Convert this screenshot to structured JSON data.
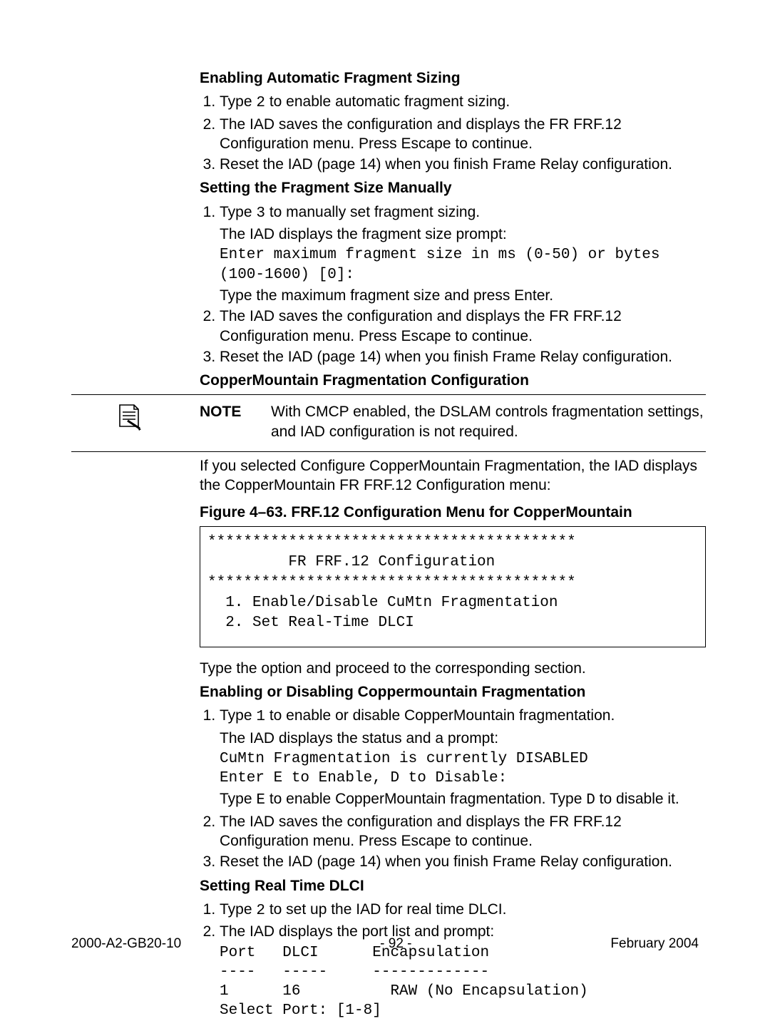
{
  "section1": {
    "heading": "Enabling Automatic Fragment Sizing",
    "step1_a": "Type ",
    "step1_key": "2",
    "step1_b": " to enable automatic fragment sizing.",
    "step2": "The IAD saves the configuration and displays the FR FRF.12 Configuration menu. Press Escape to continue.",
    "step3": "Reset the IAD (page 14) when you finish Frame Relay configuration."
  },
  "section2": {
    "heading": "Setting the Fragment Size Manually",
    "step1_a": "Type ",
    "step1_key": "3",
    "step1_b": " to manually set fragment sizing.",
    "step1_line2": "The IAD displays the fragment size prompt:",
    "step1_prompt": "Enter maximum fragment size in ms (0-50) or bytes (100-1600) [0]:",
    "step1_line3": "Type the maximum fragment size and press Enter.",
    "step2": "The IAD saves the configuration and displays the FR FRF.12 Configuration menu. Press Escape to continue.",
    "step3": "Reset the IAD (page 14) when you finish Frame Relay configuration."
  },
  "section3": {
    "heading": "CopperMountain Fragmentation Configuration",
    "note_label": "NOTE",
    "note_text": "With CMCP enabled, the DSLAM controls fragmentation settings, and IAD configuration is not required.",
    "para1": "If you selected Configure CopperMountain Fragmentation, the IAD displays the CopperMountain FR FRF.12 Configuration menu:",
    "figcap": "Figure 4–63.  FRF.12 Configuration Menu for CopperMountain",
    "codebox": "*****************************************\n         FR FRF.12 Configuration\n*****************************************\n  1. Enable/Disable CuMtn Fragmentation\n  2. Set Real-Time DLCI",
    "para2": "Type the option and proceed to the corresponding section."
  },
  "section4": {
    "heading": "Enabling or Disabling Coppermountain Fragmentation",
    "step1_a": "Type ",
    "step1_key": "1",
    "step1_b": " to enable or disable CopperMountain fragmentation.",
    "step1_line2": "The IAD displays the status and a prompt:",
    "step1_prompt": "CuMtn Fragmentation is currently DISABLED\nEnter E to Enable, D to Disable:",
    "step1_line3a": "Type ",
    "step1_key_e": "E",
    "step1_line3b": " to enable CopperMountain fragmentation. Type ",
    "step1_key_d": "D",
    "step1_line3c": " to disable it.",
    "step2": "The IAD saves the configuration and displays the FR FRF.12 Configuration menu. Press Escape to continue.",
    "step3": "Reset the IAD (page 14) when you finish Frame Relay configuration."
  },
  "section5": {
    "heading": "Setting Real Time DLCI",
    "step1_a": "Type ",
    "step1_key": "2",
    "step1_b": " to set up the IAD for real time DLCI.",
    "step2_line1": "The IAD displays the port list and prompt:",
    "step2_table": "Port   DLCI      Encapsulation\n----   -----     -------------\n1      16          RAW (No Encapsulation)\nSelect Port: [1-8]"
  },
  "footer": {
    "left": "2000-A2-GB20-10",
    "center": "- 92 -",
    "right": "February 2004"
  }
}
